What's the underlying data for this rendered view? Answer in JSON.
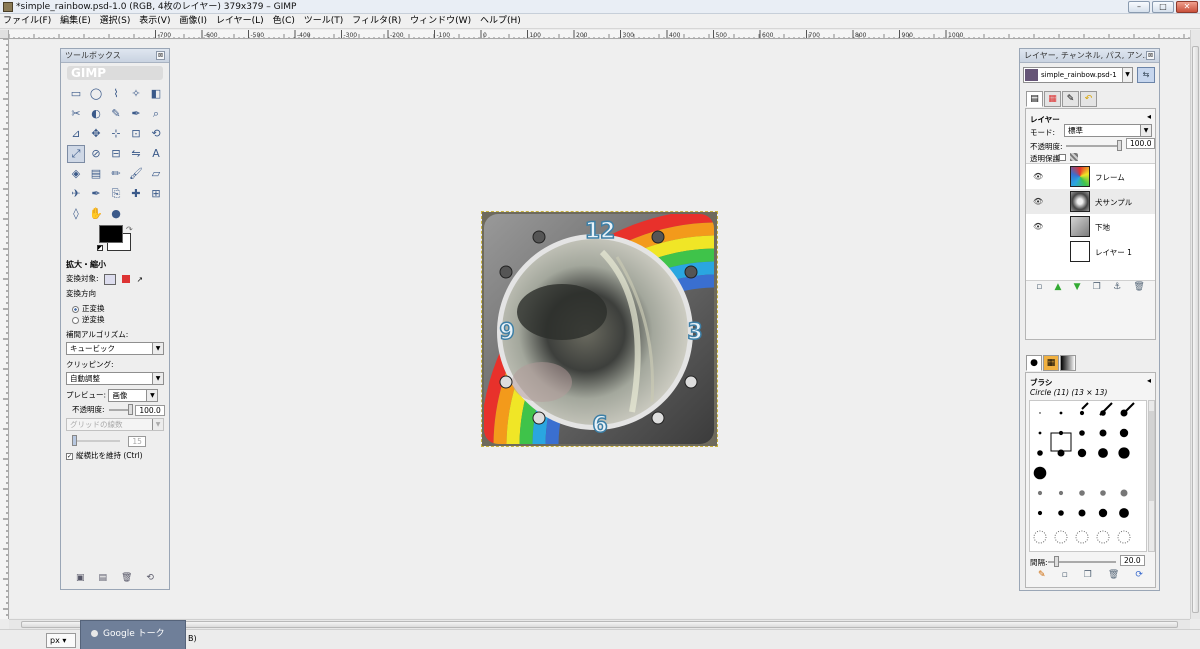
{
  "window": {
    "title": "*simple_rainbow.psd-1.0 (RGB, 4枚のレイヤー) 379x379 – GIMP",
    "minimize": "–",
    "maximize": "□",
    "close": "✕"
  },
  "menu": [
    "ファイル(F)",
    "編集(E)",
    "選択(S)",
    "表示(V)",
    "画像(I)",
    "レイヤー(L)",
    "色(C)",
    "ツール(T)",
    "フィルタ(R)",
    "ウィンドウ(W)",
    "ヘルプ(H)"
  ],
  "ruler": {
    "labels": [
      "-700",
      "-600",
      "-500",
      "-400",
      "-300",
      "-200",
      "-100",
      "0",
      "100",
      "200",
      "300",
      "400",
      "500",
      "600",
      "700",
      "800",
      "900",
      "1000"
    ]
  },
  "toolbox": {
    "title": "ツールボックス",
    "logo": "GIMP",
    "tool_icons": [
      "rect-select-icon",
      "ellipse-select-icon",
      "free-select-icon",
      "fuzzy-select-icon",
      "color-select-icon",
      "scissors-icon",
      "foreground-select-icon",
      "paths-icon",
      "color-picker-icon",
      "zoom-icon",
      "measure-icon",
      "move-icon",
      "align-icon",
      "crop-icon",
      "rotate-icon",
      "scale-icon",
      "shear-icon",
      "perspective-icon",
      "flip-icon",
      "text-icon",
      "bucket-fill-icon",
      "blend-icon",
      "pencil-icon",
      "paintbrush-icon",
      "eraser-icon",
      "airbrush-icon",
      "ink-icon",
      "clone-icon",
      "heal-icon",
      "perspective-clone-icon",
      "blur-icon",
      "smudge-icon",
      "dodge-burn-icon"
    ],
    "tool_glyphs": [
      "▭",
      "◯",
      "⌇",
      "✧",
      "◧",
      "✂",
      "◐",
      "✎",
      "✒",
      "⌕",
      "⊿",
      "✥",
      "⊹",
      "⊡",
      "⟲",
      "⤢",
      "⊘",
      "⊟",
      "⇋",
      "A",
      "◈",
      "▤",
      "✏",
      "🖌",
      "▱",
      "✈",
      "✒",
      "⎘",
      "✚",
      "⊞",
      "◊",
      "✋",
      "●"
    ],
    "active_tool_index": 15,
    "options": {
      "title": "拡大・縮小",
      "transform_label": "変換対象:",
      "direction_label": "変換方向",
      "direction_normal": "正変換",
      "direction_reverse": "逆変換",
      "interp_label": "補間アルゴリズム:",
      "interp_value": "キュービック",
      "clip_label": "クリッピング:",
      "clip_value": "自動調整",
      "preview_label": "プレビュー:",
      "preview_value": "画像",
      "opacity_label": "不透明度:",
      "opacity_value": "100.0",
      "grid_value": "グリッドの線数",
      "grid_count": "15",
      "keep_aspect": "縦横比を維持 (Ctrl)"
    }
  },
  "canvas": {
    "clock_numbers": [
      "12",
      "3",
      "6",
      "9"
    ],
    "rainbow_colors": [
      "#e8312b",
      "#f39a1b",
      "#f0e626",
      "#3fc34a",
      "#2aa6e0",
      "#3a6fd0"
    ]
  },
  "dock": {
    "title": "レイヤー, チャンネル, パス, アン...",
    "image_name": "simple_rainbow.psd-1",
    "layers_title": "レイヤー",
    "mode_label": "モード:",
    "mode_value": "標準",
    "opacity_label": "不透明度:",
    "opacity_value": "100.0",
    "lock_label": "透明保護:",
    "layers": [
      {
        "name": "フレーム",
        "visible": true
      },
      {
        "name": "犬サンプル",
        "visible": true
      },
      {
        "name": "下地",
        "visible": true
      },
      {
        "name": "レイヤー 1",
        "visible": false
      }
    ],
    "brushes_title": "ブラシ",
    "brush_name": "Circle (11) (13 × 13)",
    "spacing_label": "間隔:",
    "spacing_value": "20.0"
  },
  "statusbar": {
    "unit": "px",
    "google_talk": "Google トーク",
    "trail": "B)"
  }
}
